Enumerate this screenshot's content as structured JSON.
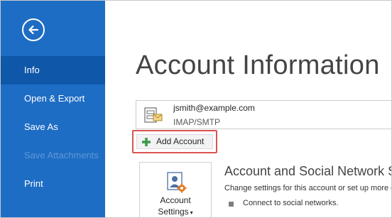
{
  "sidebar": {
    "items": [
      {
        "label": "Info",
        "state": "active"
      },
      {
        "label": "Open & Export",
        "state": "normal"
      },
      {
        "label": "Save As",
        "state": "normal"
      },
      {
        "label": "Save Attachments",
        "state": "disabled"
      },
      {
        "label": "Print",
        "state": "normal"
      }
    ]
  },
  "main": {
    "title": "Account Information",
    "account": {
      "email": "jsmith@example.com",
      "type": "IMAP/SMTP"
    },
    "add_account_label": "Add Account",
    "settings_tile": {
      "line1": "Account",
      "line2": "Settings"
    },
    "section": {
      "title": "Account and Social Network Settings",
      "description": "Change settings for this account or set up more connections.",
      "bullets": [
        "Connect to social networks."
      ]
    }
  },
  "colors": {
    "sidebar_bg": "#1e6dc4",
    "sidebar_active": "#0f57a8",
    "highlight_border": "#d9534f",
    "plus_green": "#3c9a4b",
    "settings_gear": "#e07b22"
  }
}
